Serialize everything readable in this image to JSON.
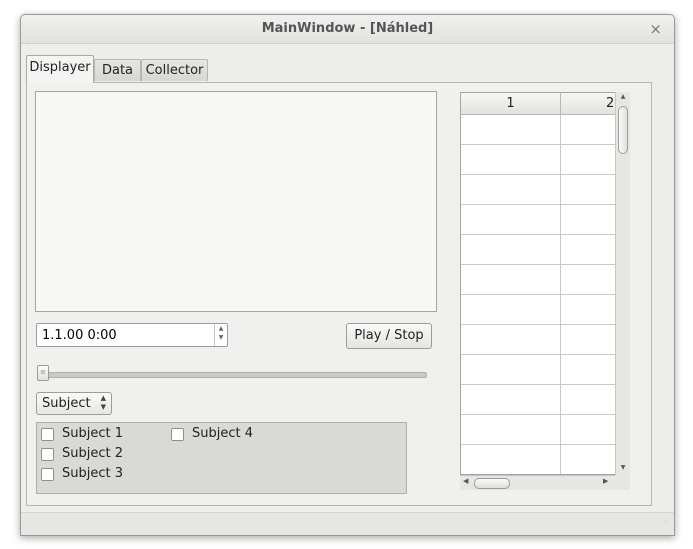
{
  "window": {
    "title": "MainWindow - [Náhled]",
    "close_glyph": "×"
  },
  "tabs": [
    {
      "label": "Displayer",
      "active": true
    },
    {
      "label": "Data",
      "active": false
    },
    {
      "label": "Collector",
      "active": false
    }
  ],
  "displayer": {
    "time_value": "1.1.00 0:00",
    "play_stop_label": "Play / Stop",
    "slider_value": 0,
    "subject_select": {
      "selected": "Subject"
    },
    "checkboxes": [
      {
        "label": "Subject 1",
        "checked": false
      },
      {
        "label": "Subject 2",
        "checked": false
      },
      {
        "label": "Subject 3",
        "checked": false
      },
      {
        "label": "Subject 4",
        "checked": false
      }
    ]
  },
  "table": {
    "columns": [
      "1",
      "2"
    ],
    "row_count": 12
  },
  "icons": {
    "close": "close-icon",
    "spin_up": "spin-up-icon",
    "spin_down": "spin-down-icon",
    "select_arrows": "updown-arrows-icon",
    "grip": "resize-grip-icon"
  }
}
